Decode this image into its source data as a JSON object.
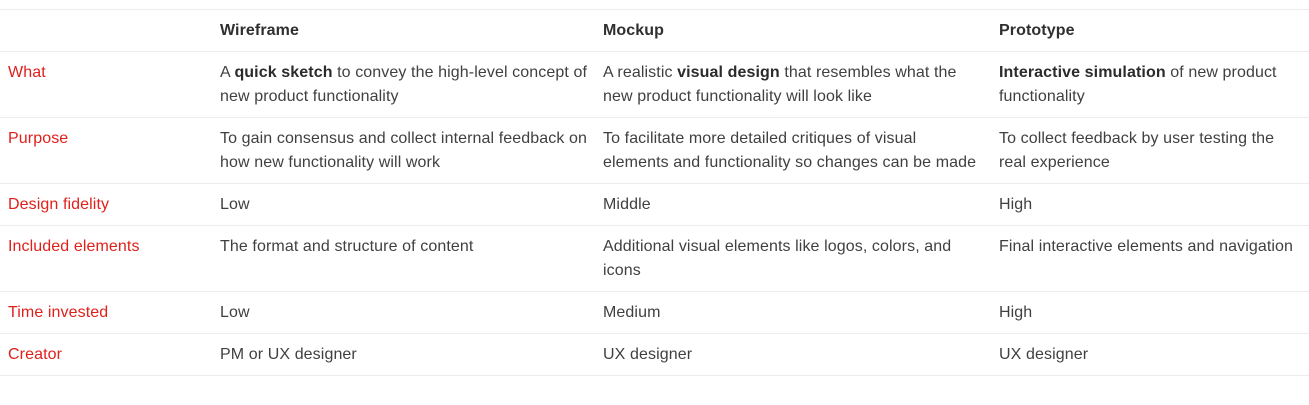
{
  "table": {
    "headers": [
      "",
      "Wireframe",
      "Mockup",
      "Prototype"
    ],
    "rows": [
      {
        "label": "What",
        "cells": [
          {
            "pre": "A ",
            "bold": "quick sketch",
            "post": " to convey the high-level concept of new product functionality"
          },
          {
            "pre": "A realistic ",
            "bold": "visual design",
            "post": " that resembles what the new product functionality will look like"
          },
          {
            "pre": "",
            "bold": "Interactive simulation",
            "post": " of new product functionality"
          }
        ]
      },
      {
        "label": "Purpose",
        "cells": [
          {
            "pre": "To gain consensus and collect internal feedback on how new functionality will work",
            "bold": "",
            "post": ""
          },
          {
            "pre": "To facilitate more detailed critiques of visual elements and functionality so changes can be made",
            "bold": "",
            "post": ""
          },
          {
            "pre": "To collect feedback by user testing the real experience",
            "bold": "",
            "post": ""
          }
        ]
      },
      {
        "label": "Design fidelity",
        "cells": [
          {
            "pre": "Low",
            "bold": "",
            "post": ""
          },
          {
            "pre": "Middle",
            "bold": "",
            "post": ""
          },
          {
            "pre": "High",
            "bold": "",
            "post": ""
          }
        ]
      },
      {
        "label": "Included elements",
        "cells": [
          {
            "pre": "The format and structure of content",
            "bold": "",
            "post": ""
          },
          {
            "pre": "Additional visual elements like logos, colors, and icons",
            "bold": "",
            "post": ""
          },
          {
            "pre": "Final interactive elements and navigation",
            "bold": "",
            "post": ""
          }
        ]
      },
      {
        "label": "Time invested",
        "cells": [
          {
            "pre": "Low",
            "bold": "",
            "post": ""
          },
          {
            "pre": "Medium",
            "bold": "",
            "post": ""
          },
          {
            "pre": "High",
            "bold": "",
            "post": ""
          }
        ]
      },
      {
        "label": "Creator",
        "cells": [
          {
            "pre": "PM or UX designer",
            "bold": "",
            "post": ""
          },
          {
            "pre": "UX designer",
            "bold": "",
            "post": ""
          },
          {
            "pre": "UX designer",
            "bold": "",
            "post": ""
          }
        ]
      }
    ]
  },
  "colors": {
    "row_label": "#e0201b",
    "body_text": "#404040",
    "divider": "#ececec"
  }
}
